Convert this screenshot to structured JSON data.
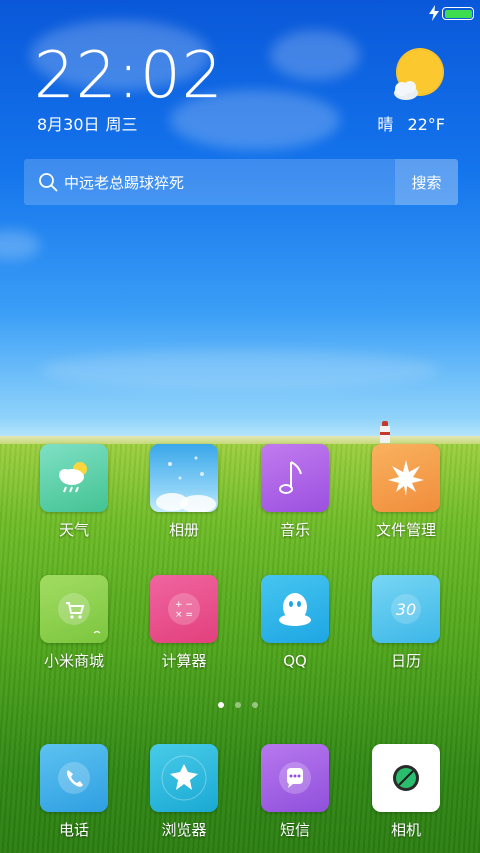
{
  "status_bar": {
    "charging_icon": "lightning-bolt-icon",
    "battery_level": 1.0,
    "battery_color": "#3edc4f"
  },
  "clock": {
    "time": "22:02",
    "date": "8月30日",
    "weekday": "周三"
  },
  "weather": {
    "icon": "partly-sunny-icon",
    "condition": "晴",
    "temperature": "22°F"
  },
  "search": {
    "query": "中远老总踢球猝死",
    "button_label": "搜索"
  },
  "apps": [
    {
      "label": "天气",
      "icon": "weather-app-icon",
      "color": "#5fd3a9"
    },
    {
      "label": "相册",
      "icon": "gallery-app-icon",
      "color": "#4fb6ef"
    },
    {
      "label": "音乐",
      "icon": "music-app-icon",
      "color": "#b066e6"
    },
    {
      "label": "文件管理",
      "icon": "file-manager-app-icon",
      "color": "#f6a24e"
    },
    {
      "label": "小米商城",
      "icon": "mi-store-app-icon",
      "color": "#8fd14f"
    },
    {
      "label": "计算器",
      "icon": "calculator-app-icon",
      "color": "#ec4f8d"
    },
    {
      "label": "QQ",
      "icon": "qq-app-icon",
      "color": "#2bb4ea"
    },
    {
      "label": "日历",
      "icon": "calendar-app-icon",
      "color": "#5bc8ee"
    }
  ],
  "page_indicator": {
    "count": 3,
    "active_index": 0
  },
  "dock": [
    {
      "label": "电话",
      "icon": "phone-app-icon",
      "color": "#43b3e8"
    },
    {
      "label": "浏览器",
      "icon": "browser-app-icon",
      "color": "#31bde0"
    },
    {
      "label": "短信",
      "icon": "messages-app-icon",
      "color": "#a15be4"
    },
    {
      "label": "相机",
      "icon": "camera-app-icon",
      "color": "#ffffff"
    }
  ]
}
